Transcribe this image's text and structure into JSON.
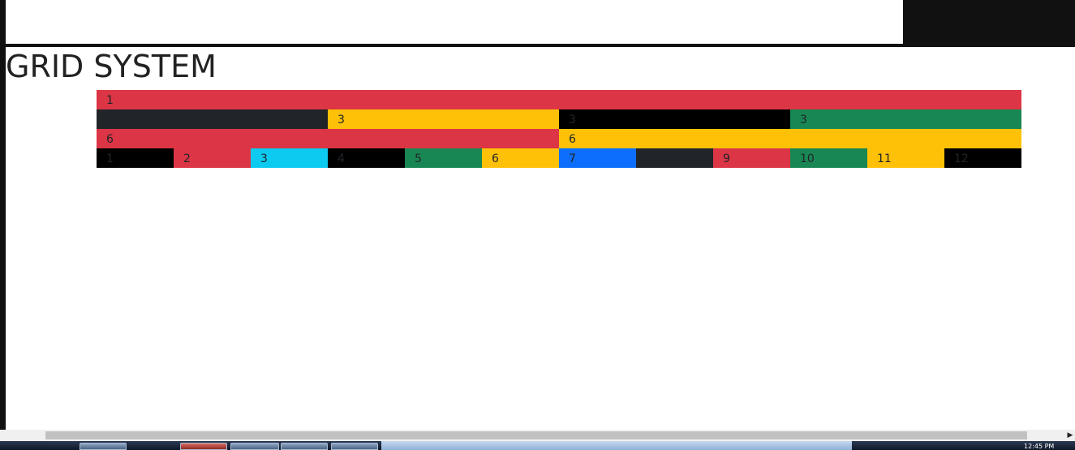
{
  "page": {
    "title": "GRID SYSTEM"
  },
  "colors": {
    "danger": "#dc3545",
    "dark": "#212529",
    "warning": "#ffc107",
    "black": "#000000",
    "success": "#198754",
    "info": "#0dcaf0",
    "primary": "#0d6efd"
  },
  "grid": {
    "rows": [
      {
        "cells": [
          {
            "span": 12,
            "label": "1",
            "color": "#dc3545"
          }
        ]
      },
      {
        "cells": [
          {
            "span": 3,
            "label": "",
            "color": "#212529"
          },
          {
            "span": 3,
            "label": "3",
            "color": "#ffc107"
          },
          {
            "span": 3,
            "label": "3",
            "color": "#000000"
          },
          {
            "span": 3,
            "label": "3",
            "color": "#198754"
          }
        ]
      },
      {
        "cells": [
          {
            "span": 6,
            "label": "6",
            "color": "#dc3545"
          },
          {
            "span": 6,
            "label": "6",
            "color": "#ffc107"
          }
        ]
      },
      {
        "cells": [
          {
            "span": 1,
            "label": "1",
            "color": "#000000"
          },
          {
            "span": 1,
            "label": "2",
            "color": "#dc3545"
          },
          {
            "span": 1,
            "label": "3",
            "color": "#0dcaf0"
          },
          {
            "span": 1,
            "label": "4",
            "color": "#000000"
          },
          {
            "span": 1,
            "label": "5",
            "color": "#198754"
          },
          {
            "span": 1,
            "label": "6",
            "color": "#ffc107"
          },
          {
            "span": 1,
            "label": "7",
            "color": "#0d6efd"
          },
          {
            "span": 1,
            "label": "",
            "color": "#212529"
          },
          {
            "span": 1,
            "label": "9",
            "color": "#dc3545"
          },
          {
            "span": 1,
            "label": "10",
            "color": "#198754"
          },
          {
            "span": 1,
            "label": "11",
            "color": "#ffc107"
          },
          {
            "span": 1,
            "label": "12",
            "color": "#000000"
          }
        ]
      }
    ]
  },
  "taskbar": {
    "clock": "12:45 PM"
  }
}
